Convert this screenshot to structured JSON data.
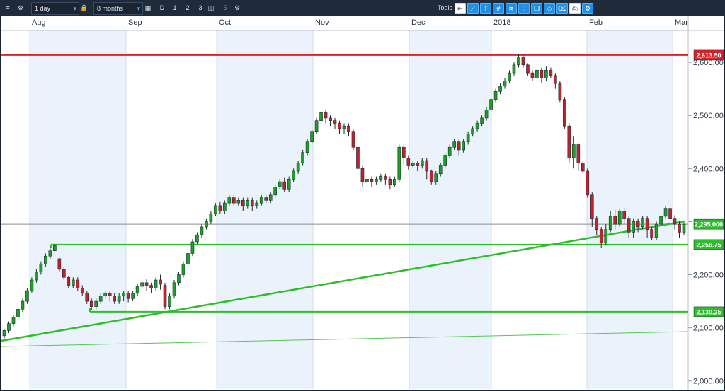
{
  "toolbar": {
    "interval": "1 day",
    "range": "8 months",
    "period_buttons": [
      "D",
      "1",
      "2",
      "3",
      "5"
    ],
    "tools_label": "Tools",
    "icons": [
      "menu-icon",
      "settings-icon",
      "lock-icon",
      "calendar-icon",
      "chart-type-icon",
      "settings-icon",
      "back-icon",
      "trendline-icon",
      "text-icon",
      "grid-icon",
      "fib-icon",
      "candle-icon",
      "layers-icon",
      "shape-icon",
      "eraser-icon",
      "print-icon",
      "share-icon"
    ]
  },
  "chart_data": {
    "type": "candlestick",
    "title": "",
    "xlabel": "",
    "ylabel": "",
    "x_labels": [
      "Aug",
      "Sep",
      "Oct",
      "Nov",
      "Dec",
      "2018",
      "Feb",
      "Mar"
    ],
    "y_ticks": [
      2000,
      2100,
      2200,
      2300,
      2400,
      2500,
      2600
    ],
    "y_tick_labels": [
      "2,000.00",
      "2,100.00",
      "2,200.00",
      "2,300.00",
      "2,400.00",
      "2,500.00",
      "2,600.00"
    ],
    "ylim": [
      1985,
      2660
    ],
    "grid": true,
    "colors": {
      "up": "#1aa321",
      "down": "#c0242a",
      "resistance": "#d9232b",
      "support": "#2ebd2b",
      "price_line": "#8c8c8c",
      "band": "#eaf3fc"
    },
    "horizontal_levels": [
      {
        "value": 2613.5,
        "label": "2,613.50",
        "color": "#d9232b"
      },
      {
        "value": 2295.0,
        "label": "2,295.000",
        "color": "#2ebd2b"
      },
      {
        "value": 2256.75,
        "label": "2,256.75",
        "color": "#2ebd2b"
      },
      {
        "value": 2130.25,
        "label": "2,130.25",
        "color": "#2ebd2b"
      }
    ],
    "candles": [
      [
        2085,
        2095,
        2080,
        2098
      ],
      [
        2095,
        2108,
        2090,
        2112
      ],
      [
        2108,
        2120,
        2103,
        2125
      ],
      [
        2120,
        2135,
        2115,
        2140
      ],
      [
        2135,
        2150,
        2130,
        2155
      ],
      [
        2150,
        2170,
        2145,
        2175
      ],
      [
        2170,
        2190,
        2165,
        2195
      ],
      [
        2190,
        2205,
        2185,
        2210
      ],
      [
        2205,
        2220,
        2200,
        2225
      ],
      [
        2220,
        2235,
        2215,
        2240
      ],
      [
        2235,
        2245,
        2230,
        2252
      ],
      [
        2245,
        2255,
        2240,
        2260
      ],
      [
        2230,
        2210,
        2205,
        2232
      ],
      [
        2210,
        2195,
        2190,
        2215
      ],
      [
        2195,
        2180,
        2175,
        2198
      ],
      [
        2180,
        2190,
        2175,
        2195
      ],
      [
        2190,
        2175,
        2170,
        2195
      ],
      [
        2175,
        2165,
        2160,
        2180
      ],
      [
        2165,
        2150,
        2145,
        2170
      ],
      [
        2150,
        2140,
        2133,
        2155
      ],
      [
        2140,
        2150,
        2135,
        2155
      ],
      [
        2150,
        2160,
        2145,
        2165
      ],
      [
        2160,
        2165,
        2155,
        2170
      ],
      [
        2165,
        2160,
        2150,
        2170
      ],
      [
        2160,
        2150,
        2145,
        2165
      ],
      [
        2150,
        2160,
        2145,
        2165
      ],
      [
        2160,
        2165,
        2150,
        2170
      ],
      [
        2165,
        2155,
        2148,
        2170
      ],
      [
        2155,
        2165,
        2150,
        2170
      ],
      [
        2165,
        2178,
        2160,
        2182
      ],
      [
        2178,
        2185,
        2172,
        2190
      ],
      [
        2185,
        2180,
        2170,
        2192
      ],
      [
        2180,
        2175,
        2165,
        2185
      ],
      [
        2175,
        2190,
        2170,
        2195
      ],
      [
        2190,
        2182,
        2172,
        2200
      ],
      [
        2180,
        2140,
        2135,
        2185
      ],
      [
        2140,
        2160,
        2135,
        2165
      ],
      [
        2160,
        2185,
        2155,
        2190
      ],
      [
        2185,
        2200,
        2180,
        2205
      ],
      [
        2200,
        2220,
        2195,
        2225
      ],
      [
        2220,
        2240,
        2215,
        2245
      ],
      [
        2240,
        2262,
        2235,
        2267
      ],
      [
        2262,
        2275,
        2258,
        2280
      ],
      [
        2275,
        2290,
        2270,
        2295
      ],
      [
        2290,
        2300,
        2285,
        2305
      ],
      [
        2300,
        2315,
        2295,
        2320
      ],
      [
        2315,
        2330,
        2310,
        2335
      ],
      [
        2330,
        2320,
        2315,
        2338
      ],
      [
        2320,
        2335,
        2315,
        2340
      ],
      [
        2335,
        2345,
        2330,
        2350
      ],
      [
        2345,
        2335,
        2330,
        2350
      ],
      [
        2335,
        2340,
        2330,
        2345
      ],
      [
        2340,
        2330,
        2320,
        2345
      ],
      [
        2330,
        2340,
        2325,
        2345
      ],
      [
        2340,
        2330,
        2320,
        2345
      ],
      [
        2330,
        2335,
        2325,
        2340
      ],
      [
        2335,
        2345,
        2330,
        2350
      ],
      [
        2345,
        2340,
        2335,
        2350
      ],
      [
        2340,
        2350,
        2335,
        2355
      ],
      [
        2350,
        2365,
        2345,
        2370
      ],
      [
        2365,
        2375,
        2360,
        2380
      ],
      [
        2375,
        2360,
        2355,
        2382
      ],
      [
        2360,
        2380,
        2355,
        2385
      ],
      [
        2380,
        2395,
        2375,
        2400
      ],
      [
        2395,
        2410,
        2390,
        2415
      ],
      [
        2410,
        2430,
        2405,
        2435
      ],
      [
        2430,
        2450,
        2425,
        2455
      ],
      [
        2450,
        2470,
        2445,
        2475
      ],
      [
        2470,
        2490,
        2465,
        2495
      ],
      [
        2490,
        2505,
        2485,
        2510
      ],
      [
        2505,
        2495,
        2485,
        2510
      ],
      [
        2495,
        2490,
        2480,
        2500
      ],
      [
        2490,
        2485,
        2475,
        2495
      ],
      [
        2485,
        2475,
        2465,
        2490
      ],
      [
        2475,
        2480,
        2465,
        2485
      ],
      [
        2480,
        2470,
        2460,
        2485
      ],
      [
        2470,
        2440,
        2435,
        2475
      ],
      [
        2440,
        2400,
        2395,
        2445
      ],
      [
        2400,
        2375,
        2365,
        2405
      ],
      [
        2375,
        2380,
        2365,
        2385
      ],
      [
        2380,
        2375,
        2365,
        2385
      ],
      [
        2375,
        2380,
        2370,
        2385
      ],
      [
        2380,
        2385,
        2375,
        2390
      ],
      [
        2385,
        2380,
        2370,
        2390
      ],
      [
        2380,
        2370,
        2360,
        2385
      ],
      [
        2370,
        2380,
        2365,
        2385
      ],
      [
        2380,
        2440,
        2375,
        2445
      ],
      [
        2440,
        2420,
        2405,
        2445
      ],
      [
        2420,
        2405,
        2398,
        2425
      ],
      [
        2405,
        2410,
        2400,
        2415
      ],
      [
        2410,
        2405,
        2395,
        2415
      ],
      [
        2405,
        2415,
        2400,
        2420
      ],
      [
        2415,
        2395,
        2380,
        2420
      ],
      [
        2395,
        2375,
        2370,
        2398
      ],
      [
        2375,
        2390,
        2370,
        2395
      ],
      [
        2390,
        2405,
        2385,
        2410
      ],
      [
        2405,
        2425,
        2400,
        2430
      ],
      [
        2425,
        2440,
        2420,
        2445
      ],
      [
        2440,
        2450,
        2435,
        2455
      ],
      [
        2450,
        2435,
        2425,
        2455
      ],
      [
        2435,
        2450,
        2430,
        2455
      ],
      [
        2450,
        2465,
        2445,
        2470
      ],
      [
        2465,
        2475,
        2460,
        2480
      ],
      [
        2475,
        2485,
        2470,
        2490
      ],
      [
        2485,
        2495,
        2480,
        2500
      ],
      [
        2495,
        2510,
        2490,
        2515
      ],
      [
        2510,
        2530,
        2505,
        2535
      ],
      [
        2530,
        2545,
        2525,
        2550
      ],
      [
        2545,
        2555,
        2540,
        2560
      ],
      [
        2555,
        2565,
        2550,
        2570
      ],
      [
        2565,
        2580,
        2560,
        2585
      ],
      [
        2580,
        2595,
        2575,
        2600
      ],
      [
        2595,
        2610,
        2590,
        2615
      ],
      [
        2610,
        2595,
        2590,
        2614
      ],
      [
        2595,
        2580,
        2575,
        2598
      ],
      [
        2580,
        2570,
        2565,
        2585
      ],
      [
        2570,
        2585,
        2565,
        2590
      ],
      [
        2585,
        2570,
        2560,
        2590
      ],
      [
        2570,
        2585,
        2565,
        2592
      ],
      [
        2585,
        2575,
        2570,
        2590
      ],
      [
        2575,
        2560,
        2550,
        2580
      ],
      [
        2560,
        2530,
        2525,
        2565
      ],
      [
        2530,
        2480,
        2475,
        2535
      ],
      [
        2480,
        2420,
        2410,
        2485
      ],
      [
        2420,
        2445,
        2400,
        2460
      ],
      [
        2445,
        2410,
        2395,
        2448
      ],
      [
        2410,
        2395,
        2390,
        2415
      ],
      [
        2395,
        2350,
        2345,
        2400
      ],
      [
        2350,
        2305,
        2290,
        2355
      ],
      [
        2305,
        2285,
        2275,
        2310
      ],
      [
        2285,
        2260,
        2250,
        2290
      ],
      [
        2260,
        2285,
        2255,
        2295
      ],
      [
        2285,
        2310,
        2280,
        2320
      ],
      [
        2310,
        2295,
        2285,
        2322
      ],
      [
        2295,
        2320,
        2290,
        2325
      ],
      [
        2320,
        2305,
        2295,
        2325
      ],
      [
        2305,
        2280,
        2270,
        2310
      ],
      [
        2280,
        2300,
        2270,
        2305
      ],
      [
        2300,
        2290,
        2280,
        2305
      ],
      [
        2290,
        2305,
        2285,
        2310
      ],
      [
        2305,
        2285,
        2270,
        2310
      ],
      [
        2285,
        2270,
        2265,
        2290
      ],
      [
        2270,
        2295,
        2265,
        2300
      ],
      [
        2295,
        2310,
        2290,
        2315
      ],
      [
        2310,
        2325,
        2305,
        2330
      ],
      [
        2325,
        2305,
        2290,
        2340
      ],
      [
        2305,
        2295,
        2285,
        2312
      ],
      [
        2295,
        2280,
        2270,
        2300
      ],
      [
        2280,
        2295,
        2275,
        2298
      ]
    ]
  }
}
